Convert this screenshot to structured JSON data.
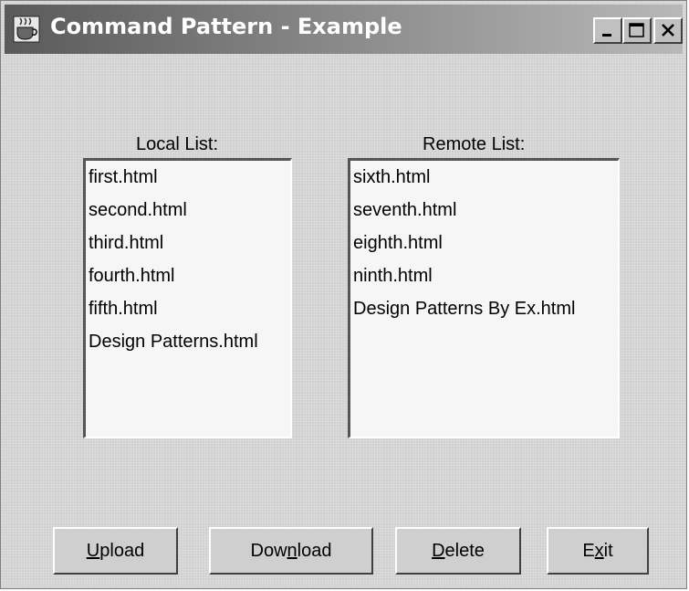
{
  "window": {
    "title": "Command Pattern - Example"
  },
  "local": {
    "label": "Local List:",
    "items": [
      "first.html",
      "second.html",
      "third.html",
      "fourth.html",
      "fifth.html",
      "Design Patterns.html"
    ]
  },
  "remote": {
    "label": "Remote List:",
    "items": [
      "sixth.html",
      "seventh.html",
      "eighth.html",
      "ninth.html",
      "Design Patterns By Ex.html"
    ]
  },
  "buttons": {
    "upload": {
      "pre": "",
      "mnemonic": "U",
      "post": "pload"
    },
    "download": {
      "pre": "Dow",
      "mnemonic": "n",
      "post": "load"
    },
    "delete": {
      "pre": "",
      "mnemonic": "D",
      "post": "elete"
    },
    "exit": {
      "pre": "E",
      "mnemonic": "x",
      "post": "it"
    }
  },
  "icons": {
    "app": "java-cup-icon",
    "minimize": "minimize-icon",
    "maximize": "maximize-icon",
    "close": "close-icon"
  }
}
